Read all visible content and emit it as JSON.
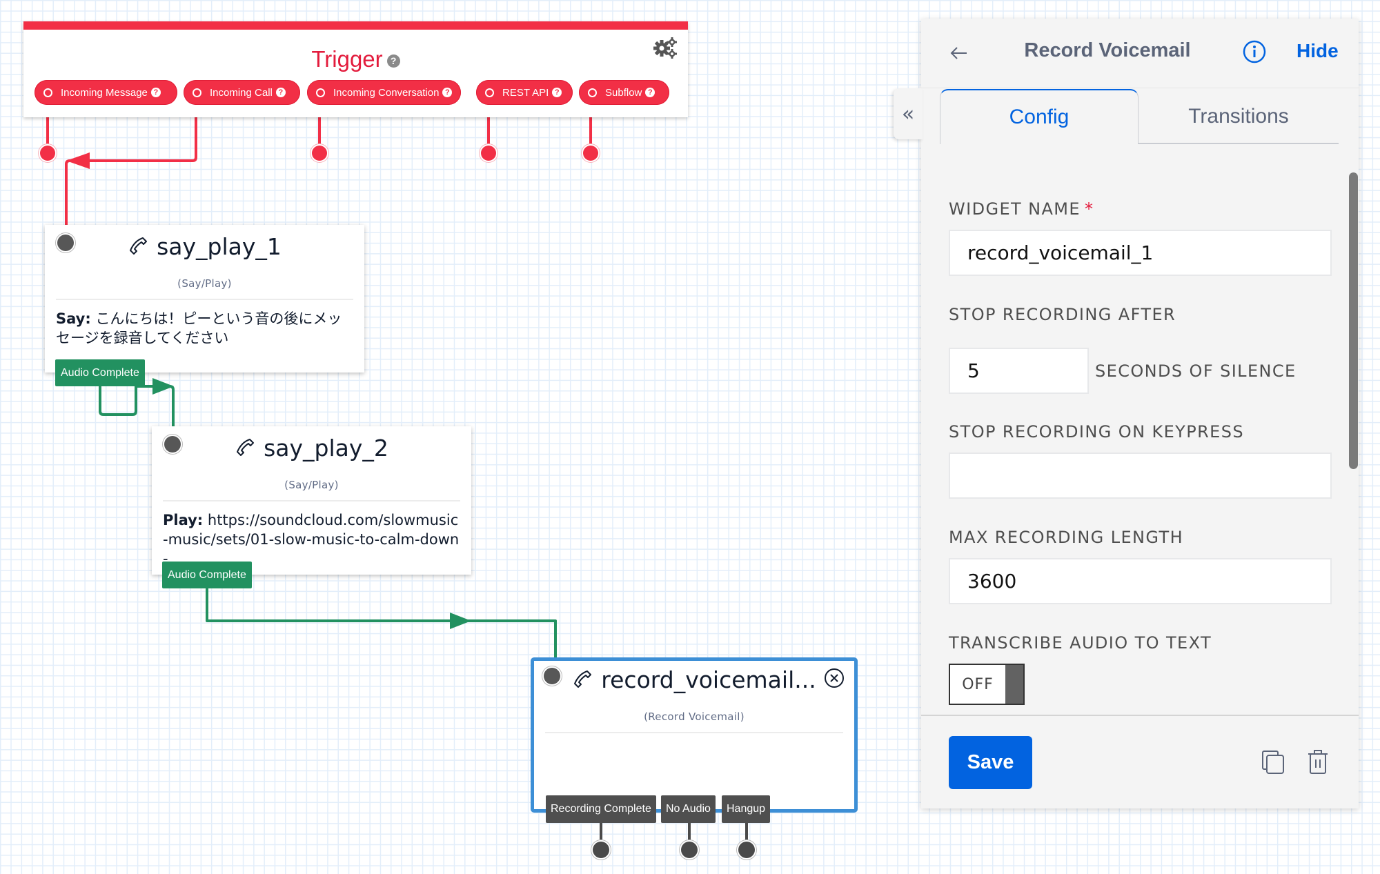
{
  "canvas": {
    "trigger": {
      "title": "Trigger",
      "help_icon": "question-circle-icon",
      "settings_icon": "gears-icon",
      "accent_color": "#f22f46",
      "pills": [
        {
          "label": "Incoming Message"
        },
        {
          "label": "Incoming Call"
        },
        {
          "label": "Incoming Conversation"
        },
        {
          "label": "REST API"
        },
        {
          "label": "Subflow"
        }
      ]
    },
    "widgets": [
      {
        "name": "say_play_1",
        "type": "(Say/Play)",
        "icon": "phone-icon",
        "body_label": "Say:",
        "body_text": "こんにちは！ピーという音の後にメッセージを録音してください",
        "transitions": [
          {
            "label": "Audio Complete",
            "color": "#229160"
          }
        ]
      },
      {
        "name": "say_play_2",
        "type": "(Say/Play)",
        "icon": "phone-icon",
        "body_label": "Play:",
        "body_text": "https://soundcloud.com/slowmusic-music/sets/01-slow-music-to-calm-down-",
        "transitions": [
          {
            "label": "Audio Complete",
            "color": "#229160"
          }
        ]
      },
      {
        "name": "record_voicemail...",
        "type": "(Record Voicemail)",
        "icon": "phone-icon",
        "selected": true,
        "selected_color": "#3d8fd6",
        "transitions": [
          {
            "label": "Recording Complete"
          },
          {
            "label": "No Audio"
          },
          {
            "label": "Hangup"
          }
        ]
      }
    ]
  },
  "panel": {
    "title": "Record Voicemail",
    "back_icon": "arrow-left-icon",
    "info_icon": "info-icon",
    "hide_label": "Hide",
    "collapse_icon": "double-chevron-left-icon",
    "collapse_glyph": "«",
    "tabs": [
      {
        "label": "Config",
        "active": true
      },
      {
        "label": "Transitions",
        "active": false
      }
    ],
    "fields": {
      "widget_name": {
        "label": "WIDGET NAME",
        "required_mark": "*",
        "value": "record_voicemail_1"
      },
      "stop_after": {
        "label": "STOP RECORDING AFTER",
        "value": "5",
        "suffix": "SECONDS OF SILENCE"
      },
      "stop_on_keypress": {
        "label": "STOP RECORDING ON KEYPRESS",
        "value": ""
      },
      "max_length": {
        "label": "MAX RECORDING LENGTH",
        "value": "3600"
      },
      "transcribe": {
        "label": "TRANSCRIBE AUDIO TO TEXT",
        "state": "OFF"
      }
    },
    "footer": {
      "save_label": "Save",
      "duplicate_icon": "copy-icon",
      "delete_icon": "trash-icon"
    },
    "accent_color": "#0263e0"
  }
}
